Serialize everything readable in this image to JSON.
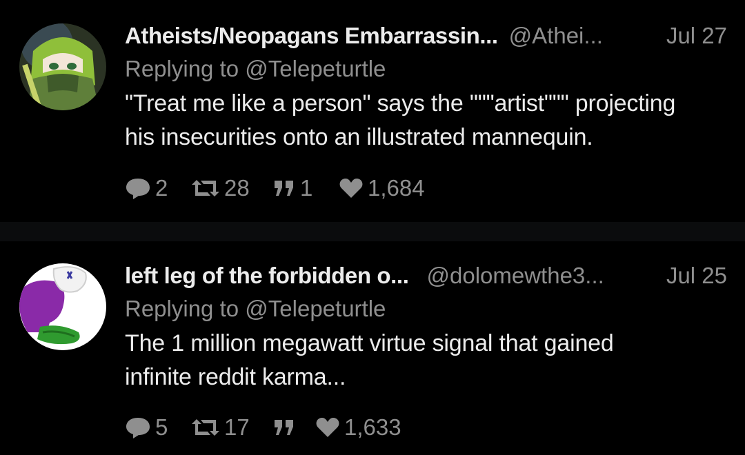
{
  "colors": {
    "background": "#000000",
    "separator": "#0b0c0d",
    "primary_text": "#ececec",
    "secondary_text": "#8f8f8f"
  },
  "tweets": [
    {
      "display_name": "Atheists/Neopagans Embarrassin...",
      "handle": "@Athei...",
      "date": "Jul 27",
      "replying_to_prefix": "Replying to",
      "replying_to": "@Telepeturtle",
      "text_lines": [
        "\"Treat me like a person\" says the \"\"\"artist\"\"\" projecting",
        "his insecurities onto an illustrated mannequin."
      ],
      "avatar_icon": "anime-character-avatar",
      "stats": {
        "replies": "2",
        "retweets": "28",
        "quotes": "1",
        "likes": "1,684"
      }
    },
    {
      "display_name": "left leg of the forbidden o...",
      "handle": "@dolomewthe3...",
      "date": "Jul 25",
      "replying_to_prefix": "Replying to",
      "replying_to": "@Telepeturtle",
      "text_lines": [
        "The 1 million megawatt virtue signal that gained",
        "infinite reddit karma..."
      ],
      "avatar_icon": "purple-leg-avatar",
      "stats": {
        "replies": "5",
        "retweets": "17",
        "quotes": "",
        "likes": "1,633"
      }
    }
  ]
}
